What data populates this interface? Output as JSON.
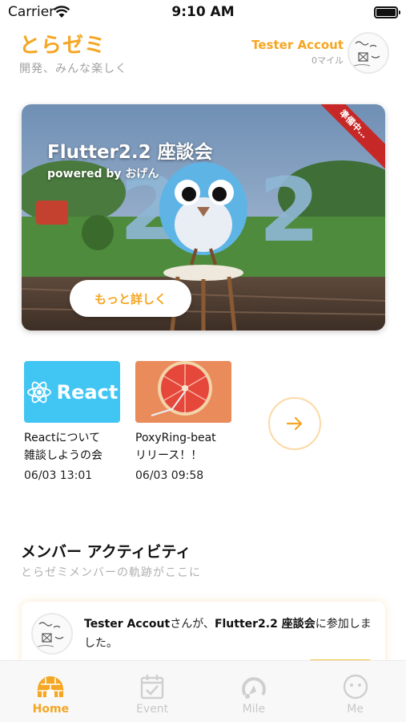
{
  "status_bar": {
    "carrier": "Carrier",
    "time": "9:10 AM"
  },
  "header": {
    "title": "とらゼミ",
    "subtitle": "開発、みんな楽しく",
    "user_name": "Tester Accout",
    "miles": "0マイル"
  },
  "hero": {
    "title": "Flutter2.2 座談会",
    "subtitle": "powered by おげん",
    "ribbon": "準備中…",
    "button": "もっと詳しく"
  },
  "events": [
    {
      "thumb_text": "React",
      "title_line1": "Reactについて",
      "title_line2": "雑談しようの会",
      "date": "06/03 13:01"
    },
    {
      "thumb_text": "",
      "title_line1": "PoxyRing-beat",
      "title_line2": "リリース！！",
      "date": "06/03 09:58"
    }
  ],
  "members_section": {
    "title": "メンバー アクティビティ",
    "subtitle": "とらゼミメンバーの軌跡がここに"
  },
  "activity": {
    "user": "Tester Accout",
    "connector": "さんが、",
    "event": "Flutter2.2 座談会",
    "suffix": "に参加しました。"
  },
  "tabs": [
    {
      "label": "Home",
      "icon": "igloo-icon",
      "active": true
    },
    {
      "label": "Event",
      "icon": "calendar-check-icon",
      "active": false
    },
    {
      "label": "Mile",
      "icon": "mile-icon",
      "active": false
    },
    {
      "label": "Me",
      "icon": "face-icon",
      "active": false
    }
  ],
  "colors": {
    "accent": "#f5a623",
    "ribbon": "#c62828",
    "react_blue": "#41c6f4"
  }
}
